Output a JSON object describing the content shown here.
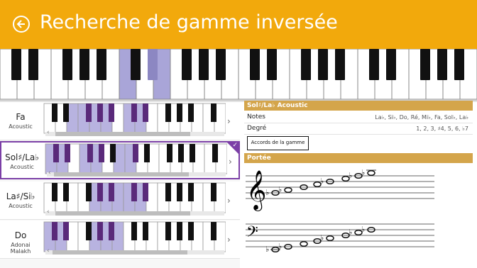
{
  "header": {
    "title": "Recherche de gamme inversée",
    "back_icon": "back-arrow-icon",
    "bg_color": "#f2a90c"
  },
  "big_keyboard": {
    "highlight_color": "#a9a5d8",
    "highlighted_white_keys": [
      7,
      9
    ],
    "highlighted_black_keys": [
      8
    ]
  },
  "scales": [
    {
      "name": "Fa",
      "mode": "Acoustic",
      "selected": false,
      "marked_keys": {
        "purple_blocks": [
          [
            2,
            5
          ],
          [
            7,
            8
          ]
        ]
      }
    },
    {
      "name": "Sol♯/La♭",
      "mode": "Acoustic",
      "selected": true,
      "marked_keys": {
        "purple_blocks": [
          [
            0,
            1
          ],
          [
            3,
            4
          ],
          [
            6,
            7
          ]
        ]
      }
    },
    {
      "name": "La♯/Si♭",
      "mode": "Acoustic",
      "selected": false,
      "marked_keys": {
        "purple_blocks": [
          [
            4,
            5
          ],
          [
            6,
            8
          ]
        ]
      }
    },
    {
      "name": "Do",
      "mode": "Adonai Malakh",
      "selected": false,
      "marked_keys": {
        "purple_blocks": [
          [
            0,
            1
          ],
          [
            4,
            6
          ]
        ]
      }
    }
  ],
  "detail": {
    "section_title": "Sol♯/La♭ Acoustic",
    "notes_label": "Notes",
    "notes_value": "La♭, Si♭, Do, Ré, Mi♭, Fa, Sol♭, La♭",
    "degree_label": "Degré",
    "degree_value": "1, 2, 3, ♯4, 5, 6, ♭7",
    "chords_button": "Accords de la gamme",
    "staff_title": "Portée",
    "accent_color": "#d4a54b"
  },
  "icons": {
    "chevron": "›",
    "check": "✓",
    "left_arrow": "‹"
  }
}
